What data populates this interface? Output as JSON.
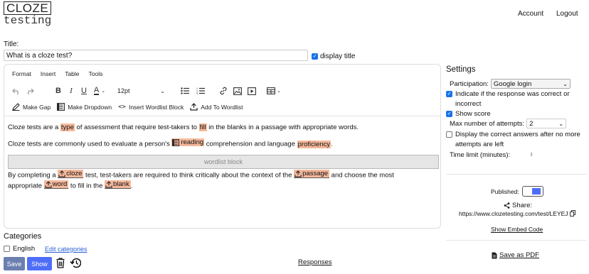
{
  "logo": {
    "line1": "CLOZE",
    "line2": "testing"
  },
  "nav": {
    "account": "Account",
    "logout": "Logout"
  },
  "title_label": "Title:",
  "title_value": "What is a cloze test?",
  "display_title": {
    "label": "display title",
    "checked": true
  },
  "editor": {
    "menu": [
      "Format",
      "Insert",
      "Table",
      "Tools"
    ],
    "font_size": "12pt",
    "actions": {
      "make_gap": "Make Gap",
      "make_dropdown": "Make Dropdown",
      "insert_wordlist": "Insert Wordlist Block",
      "add_to_wordlist": "Add To Wordlist"
    },
    "para1": {
      "t1": "Cloze tests are a ",
      "gap1": "type",
      "t2": " of assessment that require test-takers to ",
      "gap2": "fill",
      "t3": " in the blanks in a passage with appropriate words."
    },
    "para2": {
      "t1": "Cloze tests are commonly used to evaluate a person's ",
      "wordlist_word": "reading",
      "t2": " comprehension and language ",
      "gap": "proficiency",
      "t3": "."
    },
    "wordlist_block": "wordlist block",
    "para3": {
      "t1": "By completing a ",
      "drop1": "cloze",
      "t2": " test, test-takers are required to think critically about the context of the ",
      "drop2": "passage",
      "t3": " and choose the most"
    },
    "para4": {
      "t1": "appropriate ",
      "drop1": "word",
      "t2": " to fill in the ",
      "drop2": "blank",
      "t3": "."
    }
  },
  "settings": {
    "title": "Settings",
    "participation_label": "Participation:",
    "participation_value": "Google login",
    "indicate_label1": "Indicate if the response was correct or",
    "indicate_label2": "incorrect",
    "indicate_checked": true,
    "show_score_label": "Show score",
    "show_score_checked": true,
    "max_attempts_label": "Max number of attempts:",
    "max_attempts_value": "2",
    "display_correct_label1": "Display the correct answers after no more",
    "display_correct_label2": "attempts are left",
    "display_correct_checked": false,
    "time_limit_label": "Time limit (minutes):",
    "published_label": "Published:",
    "published": true,
    "share_label": "Share:",
    "share_url": "https://www.clozetesting.com/test/LEYEJ",
    "show_embed": "Show Embed Code",
    "save_pdf": "Save as PDF"
  },
  "categories": {
    "title": "Categories",
    "english": "English",
    "english_checked": false,
    "edit": "Edit categories"
  },
  "buttons": {
    "save": "Save",
    "show": "Show"
  },
  "responses": "Responses",
  "colors": {
    "gap_highlight": "#f4b89b",
    "primary": "#4f6ef7",
    "save_button": "#6b7fb0",
    "link": "#2a63d4"
  }
}
